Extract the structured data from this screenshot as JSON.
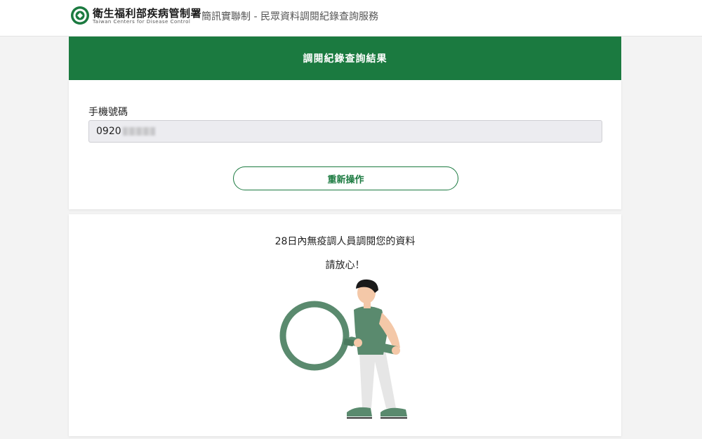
{
  "header": {
    "org_name": "衛生福利部疾病管制署",
    "org_name_en": "Taiwan Centers for Disease Control",
    "service_title": "簡訊實聯制 - 民眾資料調閱紀錄查詢服務"
  },
  "banner": {
    "title": "調閱紀錄查詢結果"
  },
  "form": {
    "phone_label": "手機號碼",
    "phone_value": "0920",
    "reset_label": "重新操作"
  },
  "result": {
    "message": "28日內無疫調人員調閱您的資料",
    "reassure": "請放心！"
  },
  "colors": {
    "brand_green": "#1b7a40",
    "illustration_green": "#5a8a6e"
  },
  "icons": {
    "logo": "cdc-logo-icon",
    "illustration": "magnifying-glass-person-illustration"
  }
}
